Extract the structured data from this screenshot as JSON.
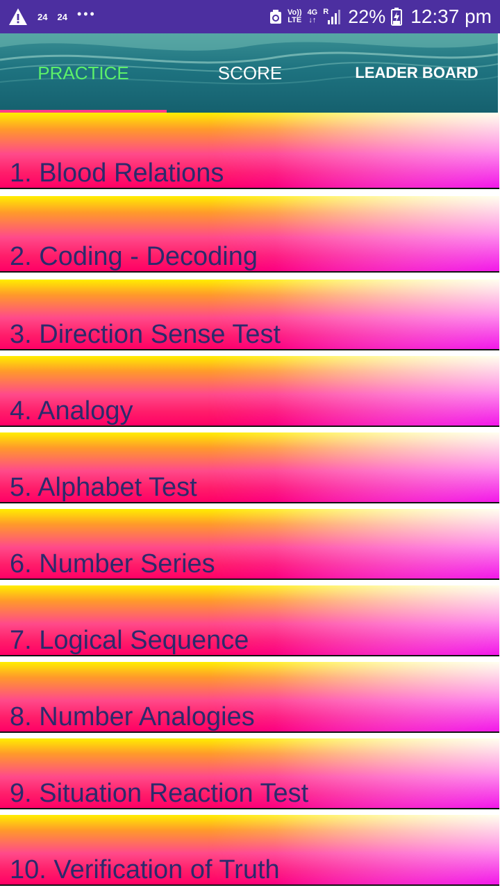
{
  "status_bar": {
    "notifications": [
      "24",
      "24"
    ],
    "overflow": "•••",
    "volte_top": "Vo))",
    "volte_bottom": "LTE",
    "network_top": "4G",
    "network_bottom": "↓↑",
    "roaming": "R",
    "battery_percent": "22%",
    "time": "12:37 pm",
    "icons": [
      "warning-icon",
      "recycle-icon",
      "signal-icon",
      "battery-charging-icon"
    ],
    "background_color": "#4c2fa0"
  },
  "tabs": [
    {
      "label": "PRACTICE",
      "active": true
    },
    {
      "label": "SCORE",
      "active": false
    },
    {
      "label": "LEADER BOARD",
      "active": false
    }
  ],
  "colors": {
    "active_tab": "#5cf06a",
    "indicator": "#ff3c8a",
    "item_text": "#2c2a6c"
  },
  "topics": [
    {
      "label": "1. Blood Relations"
    },
    {
      "label": "2. Coding - Decoding"
    },
    {
      "label": "3. Direction Sense Test"
    },
    {
      "label": "4. Analogy"
    },
    {
      "label": "5. Alphabet Test"
    },
    {
      "label": "6. Number Series"
    },
    {
      "label": "7. Logical Sequence"
    },
    {
      "label": "8. Number Analogies"
    },
    {
      "label": "9. Situation Reaction Test"
    },
    {
      "label": "10. Verification of Truth"
    }
  ]
}
